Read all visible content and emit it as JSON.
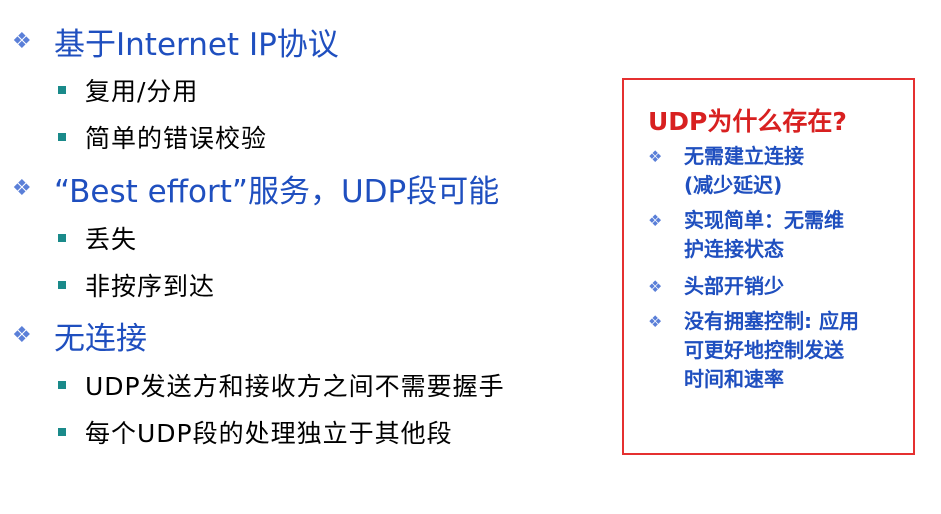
{
  "bullets": [
    {
      "text": "基于Internet IP协议",
      "children": [
        "复用/分用",
        "简单的错误校验"
      ]
    },
    {
      "text": "“Best effort”服务，UDP段可能",
      "children": [
        "丢失",
        "非按序到达"
      ]
    },
    {
      "text": "无连接",
      "children": [
        "UDP发送方和接收方之间不需要握手",
        "每个UDP段的处理独立于其他段"
      ]
    }
  ],
  "callout": {
    "title": "UDP为什么存在?",
    "items": [
      {
        "lines": [
          "无需建立连接",
          "(减少延迟)"
        ]
      },
      {
        "lines": [
          "实现简单：无需维",
          "护连接状态"
        ]
      },
      {
        "lines": [
          "头部开销少"
        ]
      },
      {
        "lines": [
          "没有拥塞控制: 应用",
          "可更好地控制发送",
          "时间和速率"
        ]
      }
    ]
  },
  "colors": {
    "heading": "#1f4fbf",
    "sub_bullet": "#1a8a8a",
    "callout_border": "#e53030",
    "callout_title": "#d82020"
  },
  "icons": {
    "level1_bullet": "four-diamond-icon",
    "level2_bullet": "square-bullet-icon"
  }
}
